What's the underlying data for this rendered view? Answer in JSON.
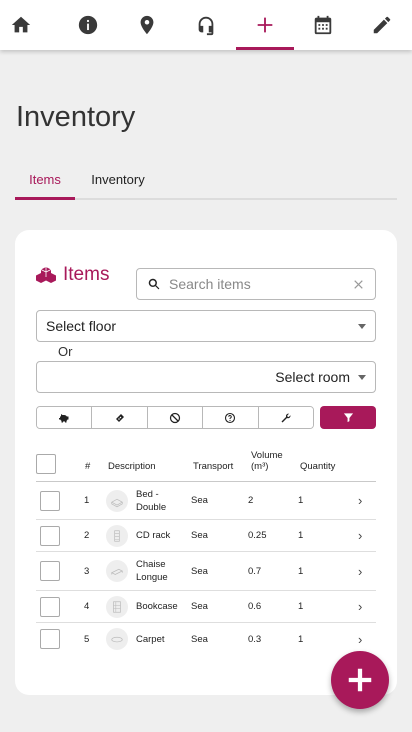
{
  "nav": {
    "items": [
      {
        "icon": "home-icon",
        "active": false
      },
      {
        "icon": "info-icon",
        "active": false
      },
      {
        "icon": "location-pin-icon",
        "active": false
      },
      {
        "icon": "headset-icon",
        "active": false
      },
      {
        "icon": "plus-icon",
        "active": true
      },
      {
        "icon": "calendar-icon",
        "active": false
      },
      {
        "icon": "pencil-icon",
        "active": false
      }
    ]
  },
  "page": {
    "title": "Inventory"
  },
  "tabs": [
    {
      "label": "Items",
      "active": true
    },
    {
      "label": "Inventory",
      "active": false
    }
  ],
  "card": {
    "title": "Items",
    "title_icon": "boxes-icon",
    "search": {
      "placeholder": "Search items",
      "value": ""
    },
    "floor_select": {
      "placeholder": "Select floor"
    },
    "or_label": "Or",
    "room_select": {
      "placeholder": "Select room"
    },
    "filter_icons": [
      "piggy-bank-icon",
      "tape-icon",
      "ban-icon",
      "question-icon",
      "wrench-icon"
    ],
    "funnel_icon": "filter-icon"
  },
  "table": {
    "headers": {
      "number": "#",
      "description": "Description",
      "transport": "Transport",
      "volume_line1": "Volume",
      "volume_line2": "(m³)",
      "quantity": "Quantity"
    },
    "rows": [
      {
        "number": "1",
        "description_l1": "Bed -",
        "description_l2": "Double",
        "transport": "Sea",
        "volume": "2",
        "quantity": "1",
        "thumb": "bed-icon"
      },
      {
        "number": "2",
        "description_l1": "CD rack",
        "description_l2": "",
        "transport": "Sea",
        "volume": "0.25",
        "quantity": "1",
        "thumb": "rack-icon"
      },
      {
        "number": "3",
        "description_l1": "Chaise",
        "description_l2": "Longue",
        "transport": "Sea",
        "volume": "0.7",
        "quantity": "1",
        "thumb": "chaise-icon"
      },
      {
        "number": "4",
        "description_l1": "Bookcase",
        "description_l2": "",
        "transport": "Sea",
        "volume": "0.6",
        "quantity": "1",
        "thumb": "bookcase-icon"
      },
      {
        "number": "5",
        "description_l1": "Carpet",
        "description_l2": "",
        "transport": "Sea",
        "volume": "0.3",
        "quantity": "1",
        "thumb": "carpet-icon"
      }
    ]
  },
  "colors": {
    "accent": "#a8195a",
    "background": "#efefef"
  }
}
